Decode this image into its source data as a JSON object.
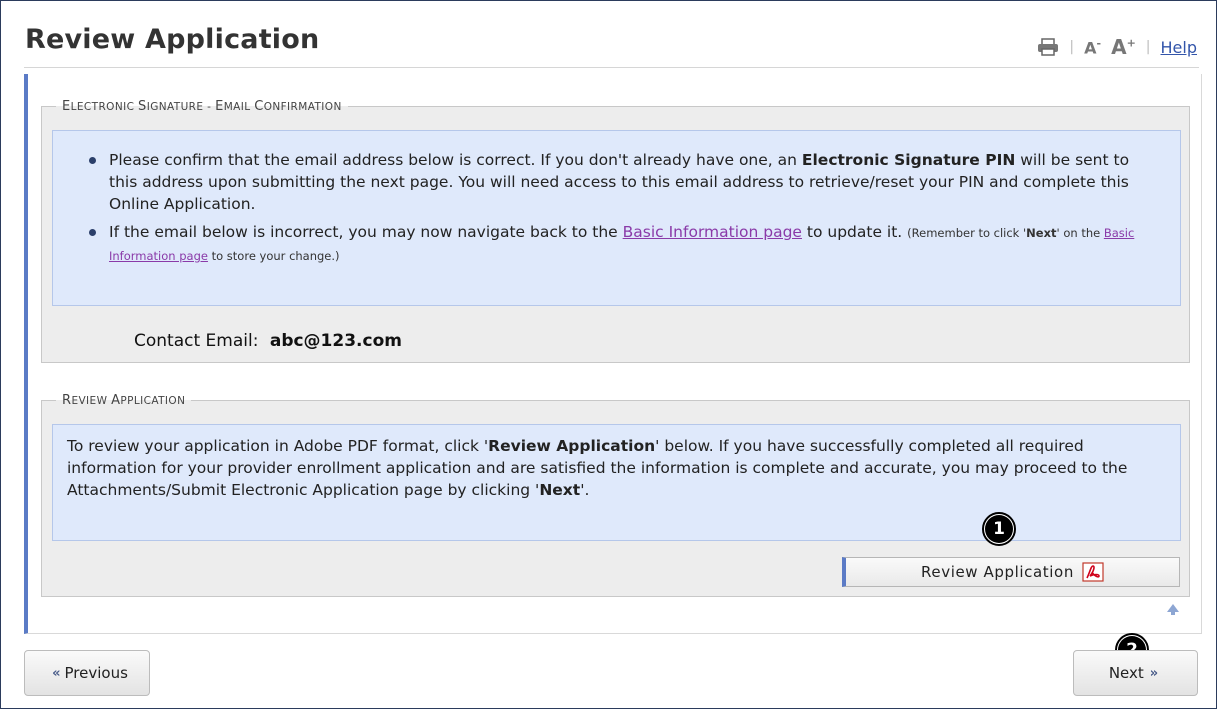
{
  "header": {
    "title": "Review Application",
    "font_small_label": "A",
    "font_small_sup": "-",
    "font_large_label": "A",
    "font_large_sup": "+",
    "separator": "|",
    "help_label": "Help",
    "icons": [
      "print-icon"
    ]
  },
  "signature_section": {
    "legend_first": "E",
    "legend_rest": "LECTRONIC ",
    "legend_s": "S",
    "legend_rest2": "IGNATURE - ",
    "legend_e2": "E",
    "legend_rest3": "MAIL ",
    "legend_c": "C",
    "legend_rest4": "ONFIRMATION",
    "bullet1_part1": "Please confirm that the email address below is correct. If you don't already have one, an ",
    "bullet1_bold": "Electronic Signature PIN",
    "bullet1_part2": " will be sent to this address upon submitting the next page. You will need access to this email address to retrieve/reset your PIN and complete this Online Application.",
    "bullet2_part1": "If the email below is incorrect, you may now navigate back to the ",
    "bullet2_link": "Basic Information page",
    "bullet2_part2": " to update it. ",
    "note_part1": "(Remember to click '",
    "note_bold": "Next",
    "note_part2": "' on the ",
    "note_link": "Basic Information page",
    "note_part3": " to store your change.)",
    "contact_label": "Contact Email:",
    "contact_value": "abc@123.com"
  },
  "review_section": {
    "legend_first": "R",
    "legend_rest": "EVIEW ",
    "legend_a": "A",
    "legend_rest2": "PPLICATION",
    "text_part1": "To review your application in Adobe PDF format, click '",
    "text_bold1": "Review Application",
    "text_part2": "' below. If you have successfully completed all required information for your provider enrollment application and are satisfied the information is complete and accurate, you may proceed to the Attachments/Submit Electronic Application page by clicking '",
    "text_bold2": "Next",
    "text_part3": "'.",
    "button_label": "Review Application",
    "button_icon": "pdf-icon"
  },
  "callouts": {
    "badge1": "1",
    "badge2": "2"
  },
  "navigation": {
    "previous_chevron": "«",
    "previous_label": "Previous",
    "next_label": "Next",
    "next_chevron": "»"
  },
  "colors": {
    "accent_border": "#5b7bc6",
    "info_panel_bg": "#dfe9fb",
    "link": "#3355aa",
    "visited_link": "#8a3aa8"
  }
}
